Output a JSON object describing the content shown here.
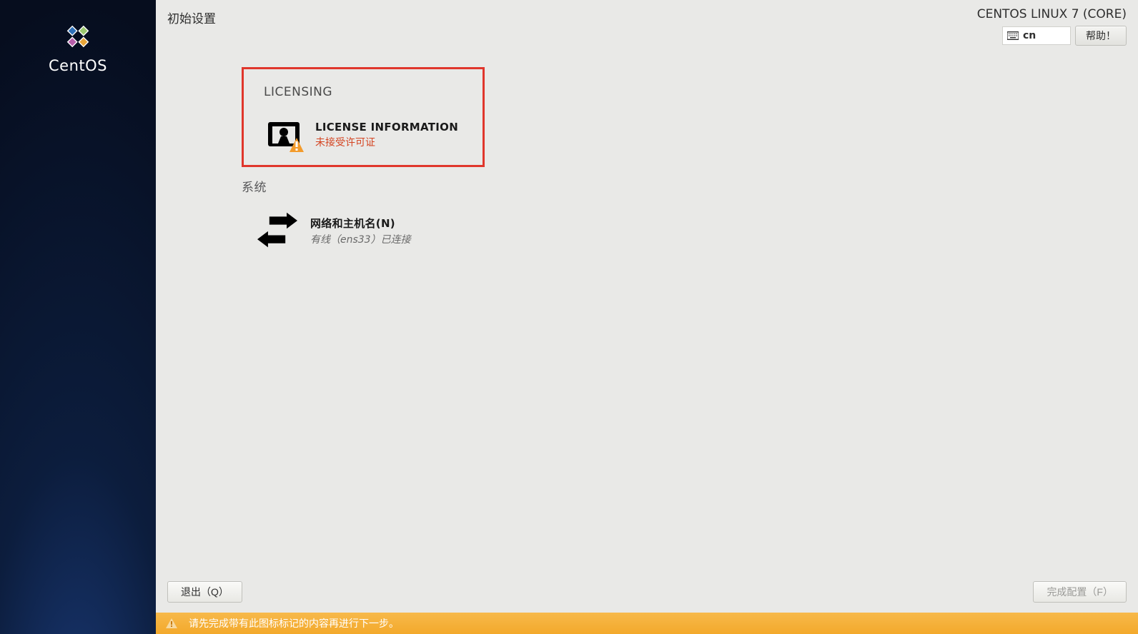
{
  "sidebar": {
    "brand": "CentOS"
  },
  "header": {
    "title": "初始设置",
    "os_label": "CENTOS LINUX 7 (CORE)",
    "keyboard_layout": "cn",
    "help_label": "帮助！"
  },
  "sections": {
    "licensing": {
      "heading": "LICENSING",
      "spoke_title": "LICENSE INFORMATION",
      "spoke_status": "未接受许可证"
    },
    "system": {
      "heading": "系统",
      "spoke_title": "网络和主机名(N)",
      "spoke_status": "有线（ens33）已连接"
    }
  },
  "footer": {
    "quit_label": "退出（Q）",
    "finish_label": "完成配置（F）"
  },
  "warn_bar": {
    "message": "请先完成带有此图标标记的内容再进行下一步。"
  }
}
